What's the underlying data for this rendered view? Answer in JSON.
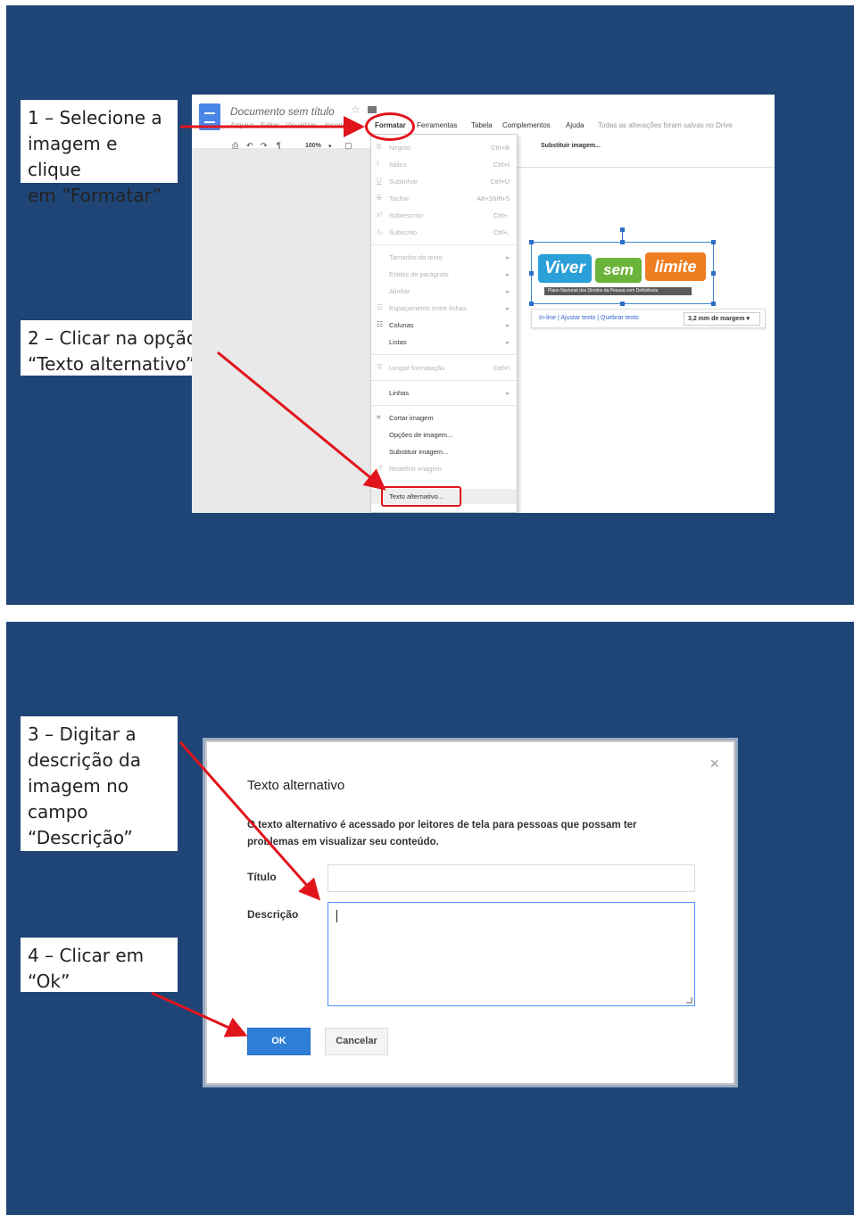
{
  "colors": {
    "background": "#1f4577",
    "accent_red": "#e1141c",
    "ok_button": "#2f7fd8"
  },
  "steps": {
    "step1": "1 – Selecione a\nimagem e clique\nem “Formatar”",
    "step2": "2 – Clicar na opção\n“Texto alternativo”",
    "step3": "3 – Digitar a\ndescrição da\nimagem no\ncampo\n“Descrição”",
    "step4": "4 – Clicar em\n“Ok”"
  },
  "gdocs": {
    "doc_title": "Documento sem título",
    "menubar": {
      "arquivo": "Arquivo",
      "editar": "Editar",
      "visualizar": "Visualizar",
      "inserir": "Inserir",
      "formatar": "Formatar",
      "ferramentas": "Ferramentas",
      "tabela": "Tabela",
      "complementos": "Complementos",
      "ajuda": "Ajuda",
      "save_status": "Todas as alterações foram salvas no Drive"
    },
    "toolbar": {
      "zoom": "100%"
    },
    "image_toolbar": {
      "substituir": "Substituir imagem..."
    },
    "format_menu": {
      "negrito": {
        "label": "Negrito",
        "shortcut": "Ctrl+B"
      },
      "italico": {
        "label": "Itálico",
        "shortcut": "Ctrl+I"
      },
      "sublinhar": {
        "label": "Sublinhar",
        "shortcut": "Ctrl+U"
      },
      "tachar": {
        "label": "Tachar",
        "shortcut": "Alt+Shift+5"
      },
      "sobrescrito": {
        "label": "Sobrescrito",
        "shortcut": "Ctrl+."
      },
      "subscrito": {
        "label": "Subscrito",
        "shortcut": "Ctrl+,"
      },
      "tamanho": "Tamanho do texto",
      "estilos": "Estilos de parágrafo",
      "alinhar": "Alinhar",
      "espacamento": "Espaçamento entre linhas",
      "colunas": "Colunas",
      "listas": "Listas",
      "limpar": {
        "label": "Limpar formatação",
        "shortcut": "Ctrl+\\"
      },
      "linhas": "Linhas",
      "cortar": "Cortar imagem",
      "opcoes": "Opções de imagem...",
      "substituir": "Substituir imagem...",
      "redefinir": "Redefinir imagem",
      "texto_alternativo": "Texto alternativo..."
    },
    "logo": {
      "word1": "Viver",
      "word2": "sem",
      "word3": "limite",
      "subtitle": "Plano Nacional dos Direitos da Pessoa com Deficiência"
    },
    "image_options": {
      "links": "In-line | Ajustar texto | Quebrar texto",
      "margin": "3,2 mm de margem ▾"
    }
  },
  "dialog": {
    "title": "Texto alternativo",
    "description": "O texto alternativo é acessado por leitores de tela para pessoas que possam ter problemas em visualizar seu conteúdo.",
    "titulo_label": "Título",
    "titulo_value": "",
    "descricao_label": "Descrição",
    "descricao_value": "",
    "ok": "OK",
    "cancel": "Cancelar",
    "close": "×"
  }
}
